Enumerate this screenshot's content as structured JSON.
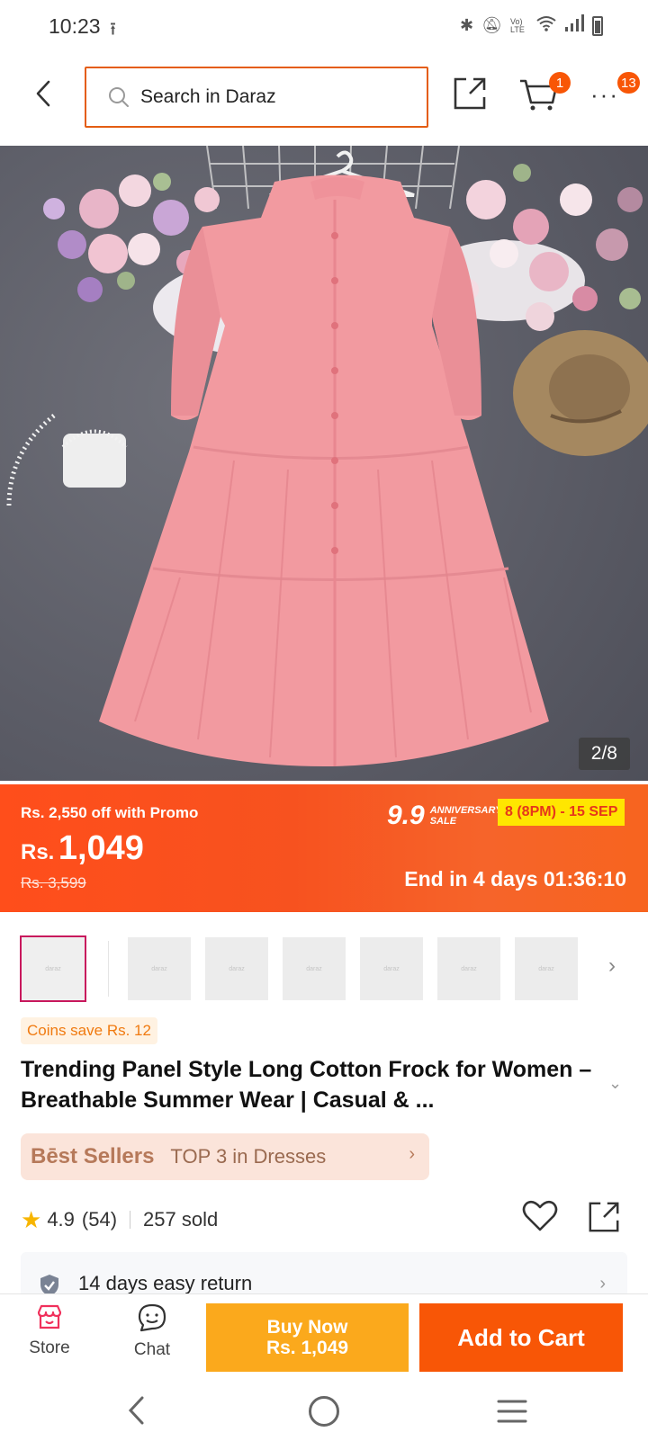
{
  "status_bar": {
    "time": "10:23",
    "upload_icon": "upload-icon",
    "bluetooth_icon": "bluetooth-icon",
    "mute_icon": "bell-off-icon",
    "volte": "Vo) LTE",
    "wifi_icon": "wifi-icon",
    "signal_icon": "signal-icon",
    "battery_icon": "battery-icon"
  },
  "header": {
    "search_placeholder": "Search in Daraz",
    "cart_badge": "1",
    "more_badge": "13"
  },
  "hero": {
    "counter": "2/8"
  },
  "price": {
    "promo_line": "Rs. 2,550 off with Promo",
    "currency": "Rs.",
    "amount": "1,049",
    "original": "Rs. 3,599",
    "sale_number": "9.9",
    "sale_word_1": "ANNIVERSARY",
    "sale_word_2": "SALE",
    "sale_dates": "8 (8PM) - 15 SEP",
    "countdown": "End in 4 days 01:36:10"
  },
  "thumbnails": {
    "placeholder_text": "daraz",
    "count": 7,
    "selected_index": 0
  },
  "product": {
    "coins": "Coins save Rs. 12",
    "title": "Trending Panel Style Long Cotton Frock for Women – Breathable Summer Wear | Casual & ...",
    "best_sellers_tag": "Bēst Sellers",
    "best_sellers_text": "TOP 3 in Dresses",
    "rating": "4.9",
    "reviews": "(54)",
    "sold": "257 sold",
    "return_policy": "14 days easy return"
  },
  "actions": {
    "store_label": "Store",
    "chat_label": "Chat",
    "buy_now_label": "Buy Now",
    "buy_now_price": "Rs. 1,049",
    "add_to_cart_label": "Add to Cart"
  },
  "colors": {
    "accent": "#f85606",
    "search_border": "#e45d12",
    "buy_now": "#fba91c",
    "sale_yellow": "#ffe600",
    "star": "#f7b500"
  }
}
